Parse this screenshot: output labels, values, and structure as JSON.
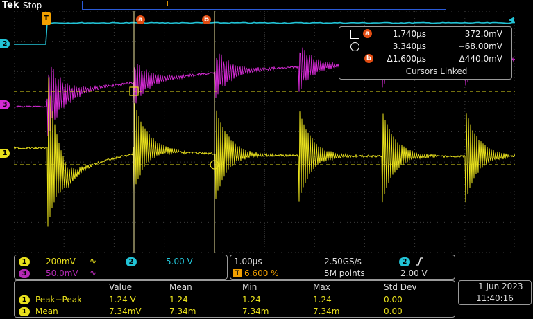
{
  "header": {
    "brand": "Tek",
    "status": "Stop"
  },
  "markers": {
    "trigger": "T",
    "ch2": "2",
    "ch3": "3",
    "ch1": "1",
    "cursor_a": "a",
    "cursor_b": "b"
  },
  "cursor_readout": {
    "row_a": {
      "time": "1.740µs",
      "value": "372.0mV"
    },
    "row_b": {
      "time": "3.340µs",
      "value": "−68.00mV"
    },
    "row_delta": {
      "time": "Δ1.600µs",
      "value": "Δ440.0mV"
    },
    "linked": "Cursors Linked"
  },
  "vertical_panel": {
    "ch1": {
      "num": "1",
      "scale": "200mV",
      "coupling_icon": "∿"
    },
    "ch2": {
      "num": "2",
      "scale": "5.00 V"
    },
    "ch3": {
      "num": "3",
      "scale": "50.0mV",
      "coupling_icon": "∿"
    }
  },
  "horizontal_panel": {
    "timebase": "1.00µs",
    "sample_rate": "2.50GS/s",
    "trigger_pos": "6.600 %",
    "record": "5M points",
    "trigger_source": "2",
    "trigger_slope_icon": "rising-edge-icon",
    "trigger_level": "2.00 V"
  },
  "measurements": {
    "headers": [
      "Value",
      "Mean",
      "Min",
      "Max",
      "Std Dev"
    ],
    "rows": [
      {
        "ch": "1",
        "name": "Peak−Peak",
        "values": [
          "1.24 V",
          "1.24",
          "1.24",
          "1.24",
          "0.00"
        ]
      },
      {
        "ch": "1",
        "name": "Mean",
        "values": [
          "7.34mV",
          "7.34m",
          "7.34m",
          "7.34m",
          "0.00"
        ]
      }
    ]
  },
  "datetime": {
    "date": "1 Jun  2023",
    "time": "11:40:16"
  },
  "colors": {
    "ch1": "#e8e01c",
    "ch2": "#22c3d6",
    "ch3": "#d62bd6",
    "cursor": "#f0e6a0",
    "accent": "#e24c12"
  }
}
